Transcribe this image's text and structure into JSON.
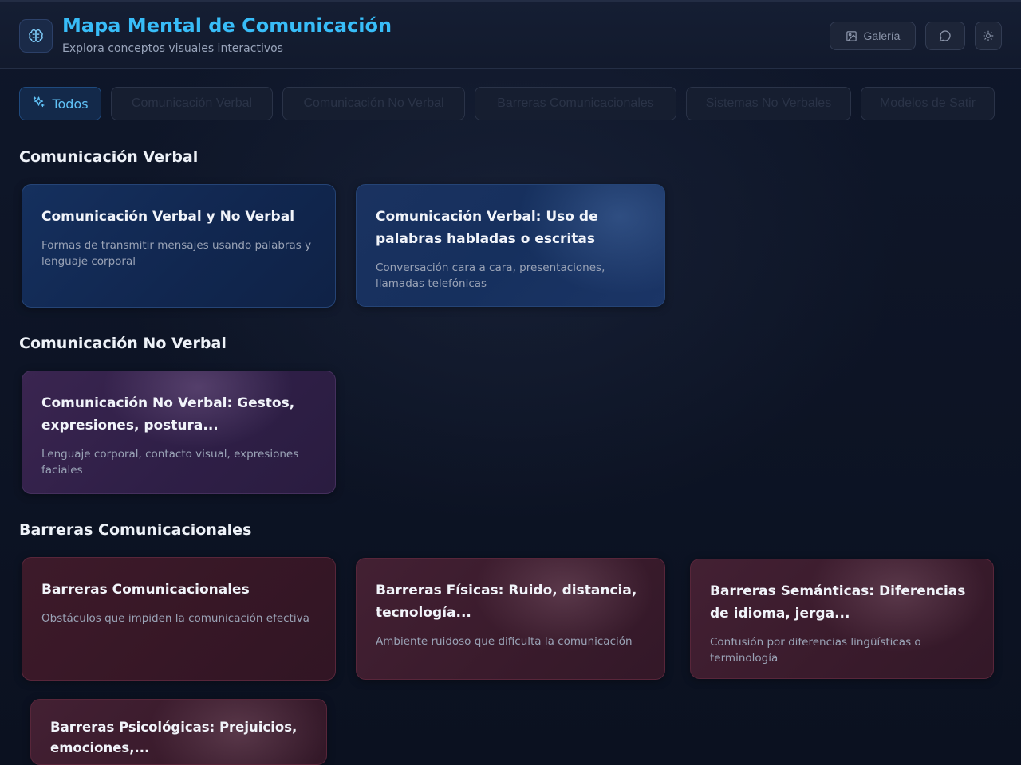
{
  "header": {
    "title": "Mapa Mental de Comunicación",
    "subtitle": "Explora conceptos visuales interactivos",
    "logo_icon": "brain-icon",
    "gallery_label": "Galería",
    "gallery_icon": "image-icon",
    "chat_icon": "chat-bubble-icon",
    "theme_icon": "sun-icon"
  },
  "filters": [
    {
      "label": "Todos",
      "icon": "sparkles-icon",
      "active": true
    },
    {
      "label": "Comunicación Verbal",
      "active": false
    },
    {
      "label": "Comunicación No Verbal",
      "active": false
    },
    {
      "label": "Barreras Comunicacionales",
      "active": false
    },
    {
      "label": "Sistemas No Verbales",
      "active": false
    },
    {
      "label": "Modelos de Satir",
      "active": false
    }
  ],
  "sections": [
    {
      "title": "Comunicación Verbal",
      "cards": [
        {
          "title": "Comunicación Verbal y No Verbal",
          "description": "Formas de transmitir mensajes usando palabras y lenguaje corporal"
        },
        {
          "title": "Comunicación Verbal: Uso de palabras habladas o escritas",
          "description": "Conversación cara a cara, presentaciones, llamadas telefónicas"
        }
      ]
    },
    {
      "title": "Comunicación No Verbal",
      "cards": [
        {
          "title": "Comunicación No Verbal: Gestos, expresiones, postura...",
          "description": "Lenguaje corporal, contacto visual, expresiones faciales"
        }
      ]
    },
    {
      "title": "Barreras Comunicacionales",
      "cards": [
        {
          "title": "Barreras Comunicacionales",
          "description": "Obstáculos que impiden la comunicación efectiva"
        },
        {
          "title": "Barreras Físicas: Ruido, distancia, tecnología...",
          "description": "Ambiente ruidoso que dificulta la comunicación"
        },
        {
          "title": "Barreras Semánticas: Diferencias de idioma, jerga...",
          "description": "Confusión por diferencias lingüísticas o terminología"
        },
        {
          "title": "Barreras Psicológicas: Prejuicios, emociones,...",
          "description": ""
        }
      ]
    }
  ],
  "colors": {
    "accent": "#38bdf8",
    "verbal": "#15305e",
    "no_verbal": "#3a2550",
    "barreras": "#3d1a2a"
  }
}
